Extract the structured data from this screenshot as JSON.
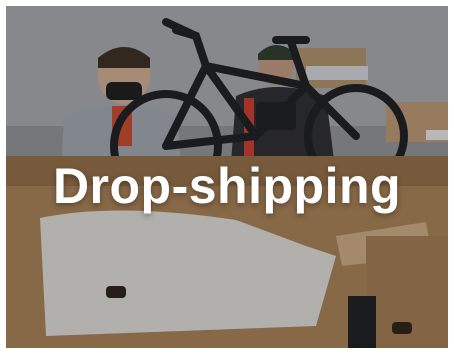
{
  "card": {
    "title": "Drop-shipping",
    "photo_subject": "bike-packing-photo"
  },
  "colors": {
    "title_text": "#ffffff",
    "page_background": "#ffffff"
  }
}
